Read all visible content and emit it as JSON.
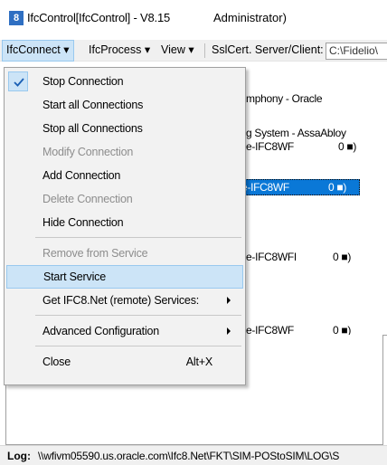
{
  "window": {
    "icon_text": "8",
    "title": "IfcControl[IfcControl] - V8.15",
    "admin_label": "Administrator)"
  },
  "menubar": {
    "items": [
      {
        "label": "IfcConnect ▾"
      },
      {
        "label": "IfcProcess ▾"
      },
      {
        "label": "View ▾"
      },
      {
        "label": "SslCert. Server/Client:"
      }
    ],
    "path_value": "C:\\Fidelio\\"
  },
  "background": {
    "line1": "mphony - Oracle",
    "line2": "g System - AssaAbloy",
    "line3_name": "e-IFC8WF",
    "line3_status": "0 ■)",
    "selected_name": "e-IFC8WF",
    "selected_status": "0 ■)",
    "line5_name": "e-IFC8WFI",
    "line5_status": "0 ■)",
    "line6_name": "e-IFC8WF",
    "line6_status": "0 ■)"
  },
  "dropdown": {
    "checked_icon": "checkmark-icon",
    "items": [
      {
        "label": "Stop Connection",
        "disabled": false,
        "checked": true
      },
      {
        "label": "Start all Connections",
        "disabled": false
      },
      {
        "label": "Stop all Connections",
        "disabled": false
      },
      {
        "label": "Modify Connection",
        "disabled": true
      },
      {
        "label": "Add Connection",
        "disabled": false
      },
      {
        "label": "Delete Connection",
        "disabled": true
      },
      {
        "label": "Hide Connection",
        "disabled": false
      },
      {
        "label": "Remove from Service",
        "disabled": true
      },
      {
        "label": "Start Service",
        "disabled": false,
        "highlighted": true
      },
      {
        "label": "Get IFC8.Net (remote) Services:",
        "disabled": false,
        "submenu": true
      },
      {
        "label": "Advanced Configuration",
        "disabled": false,
        "submenu": true
      },
      {
        "label": "Close",
        "disabled": false,
        "shortcut": "Alt+X"
      }
    ]
  },
  "statusbar": {
    "label": "Log:",
    "path": "\\\\wfivm05590.us.oracle.com\\Ifc8.Net\\FKT\\SIM-POStoSIM\\LOG\\S"
  },
  "colors": {
    "selection": "#0a78d7",
    "highlight": "#cce4f7",
    "highlight_border": "#99c9ef",
    "menu_bg": "#f2f2f2"
  }
}
